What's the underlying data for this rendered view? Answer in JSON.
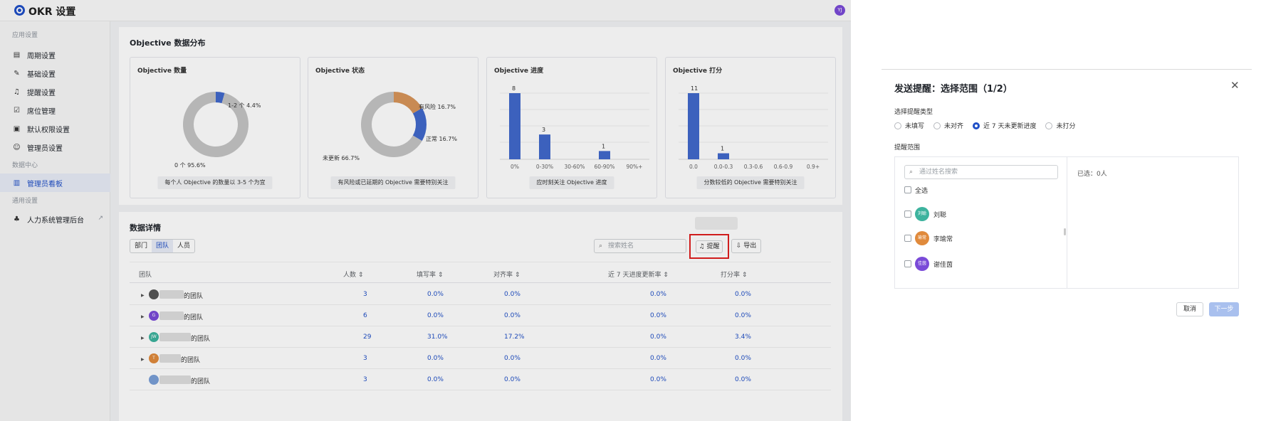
{
  "app": {
    "title": "OKR 设置",
    "avatar": "YJ"
  },
  "sidebar": {
    "section1": "应用设置",
    "items1": [
      {
        "label": "周期设置",
        "icon": "calendar-icon"
      },
      {
        "label": "基础设置",
        "icon": "wrench-icon"
      },
      {
        "label": "提醒设置",
        "icon": "bell-icon"
      },
      {
        "label": "席位管理",
        "icon": "seat-icon"
      },
      {
        "label": "默认权限设置",
        "icon": "lock-icon"
      },
      {
        "label": "管理员设置",
        "icon": "user-icon"
      }
    ],
    "section2": "数据中心",
    "dashboard": {
      "label": "管理员看板",
      "icon": "bar-chart-icon"
    },
    "section3": "通用设置",
    "hr": {
      "label": "人力系统管理后台",
      "icon": "org-icon"
    }
  },
  "distribution": {
    "title": "Objective 数据分布",
    "count": {
      "title": "Objective 数量",
      "label_a": "1-2 个 4.4%",
      "label_b": "0 个 95.6%",
      "caption": "每个人 Objective 的数量以 3-5 个为宜"
    },
    "status": {
      "title": "Objective 状态",
      "label_risk": "有风险 16.7%",
      "label_normal": "正常 16.7%",
      "label_none": "未更新 66.7%",
      "caption": "有风险或已延期的 Objective 需要特别关注"
    },
    "progress": {
      "title": "Objective 进度",
      "caption": "应时刻关注 Objective 进度"
    },
    "score": {
      "title": "Objective 打分",
      "caption": "分数较低的 Objective 需要特别关注"
    }
  },
  "chart_data": [
    {
      "type": "pie",
      "title": "Objective 数量",
      "categories": [
        "1-2 个",
        "0 个"
      ],
      "values": [
        4.4,
        95.6
      ]
    },
    {
      "type": "pie",
      "title": "Objective 状态",
      "categories": [
        "有风险",
        "正常",
        "未更新"
      ],
      "values": [
        16.7,
        16.7,
        66.7
      ]
    },
    {
      "type": "bar",
      "title": "Objective 进度",
      "categories": [
        "0%",
        "0-30%",
        "30-60%",
        "60-90%",
        "90%+"
      ],
      "values": [
        8,
        3,
        0,
        1,
        0
      ]
    },
    {
      "type": "bar",
      "title": "Objective 打分",
      "categories": [
        "0.0",
        "0.0-0.3",
        "0.3-0.6",
        "0.6-0.9",
        "0.9+"
      ],
      "values": [
        11,
        1,
        0,
        0,
        0
      ]
    }
  ],
  "details": {
    "title": "数据详情",
    "tabs": [
      "部门",
      "团队",
      "人员"
    ],
    "search_placeholder": "搜索姓名",
    "remind": "提醒",
    "export": "导出",
    "columns": [
      "团队",
      "人数 ⇕",
      "填写率 ⇕",
      "对齐率 ⇕",
      "近 7 天进度更新率 ⇕",
      "打分率 ⇕"
    ],
    "rows": [
      {
        "name": "的团队",
        "avatar": "",
        "count": "3",
        "fill": "0.0%",
        "align": "0.0%",
        "update": "0.0%",
        "score": "0.0%"
      },
      {
        "name": "的团队",
        "avatar": "G",
        "count": "6",
        "fill": "0.0%",
        "align": "0.0%",
        "update": "0.0%",
        "score": "0.0%"
      },
      {
        "name": "的团队",
        "avatar": "JW",
        "count": "29",
        "fill": "31.0%",
        "align": "17.2%",
        "update": "0.0%",
        "score": "3.4%"
      },
      {
        "name": "的团队",
        "avatar": "T",
        "count": "3",
        "fill": "0.0%",
        "align": "0.0%",
        "update": "0.0%",
        "score": "0.0%"
      },
      {
        "name": "的团队",
        "avatar": "",
        "count": "3",
        "fill": "0.0%",
        "align": "0.0%",
        "update": "0.0%",
        "score": "0.0%"
      }
    ]
  },
  "panel": {
    "title": "发送提醒：选择范围（1/2）",
    "type_label": "选择提醒类型",
    "types": [
      "未填写",
      "未对齐",
      "近 7 天未更新进度",
      "未打分"
    ],
    "scope_label": "提醒范围",
    "search_placeholder": "通过姓名搜索",
    "select_all": "全选",
    "people": [
      {
        "name": "刘聪",
        "avatar": "刘聪",
        "color": "#3db39e"
      },
      {
        "name": "李瑜常",
        "avatar": "瑜常",
        "color": "#e08a3c"
      },
      {
        "name": "谢佳茵",
        "avatar": "佳茵",
        "color": "#7a4ad8"
      }
    ],
    "selected": "已选：0人",
    "cancel": "取消",
    "next": "下一步"
  }
}
